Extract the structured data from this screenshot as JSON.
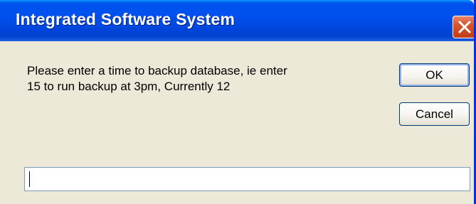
{
  "window": {
    "title": "Integrated Software System"
  },
  "dialog": {
    "message_line1": "Please enter a time to backup database, ie enter",
    "message_line2": "15 to run backup at 3pm, Currently 12",
    "ok_label": "OK",
    "cancel_label": "Cancel",
    "input_value": ""
  },
  "icons": {
    "close": "close-icon"
  },
  "colors": {
    "titlebar": "#0050EE",
    "close_button": "#D8542F",
    "dialog_background": "#ECE9D8"
  }
}
